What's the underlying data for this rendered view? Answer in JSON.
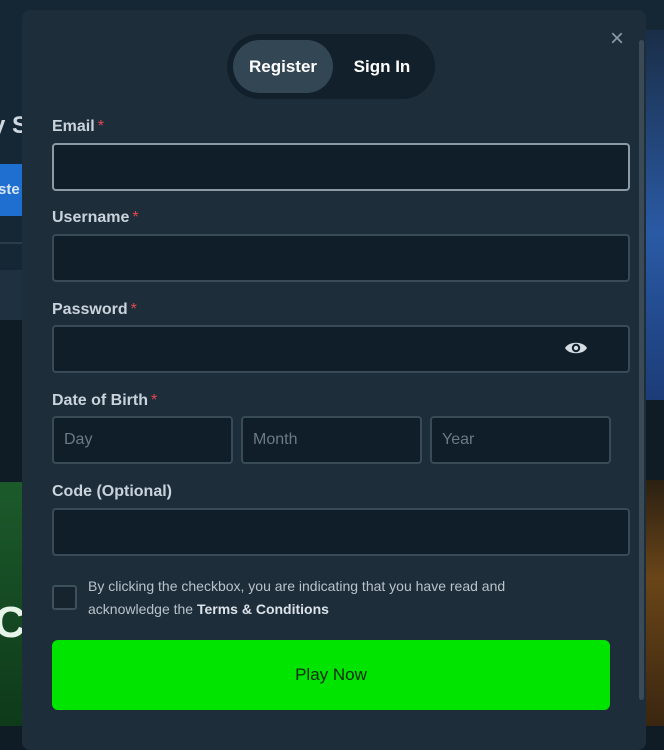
{
  "background": {
    "left_text": "y S",
    "left_button": "ste",
    "left_green_letter": "C"
  },
  "tabs": [
    {
      "label": "Register",
      "active": true
    },
    {
      "label": "Sign In",
      "active": false
    }
  ],
  "close_icon": "×",
  "form": {
    "email_label": "Email",
    "username_label": "Username",
    "password_label": "Password",
    "dob_label": "Date of Birth",
    "code_label": "Code (Optional)",
    "required_marker": "*",
    "dob": {
      "day_placeholder": "Day",
      "month_placeholder": "Month",
      "year_placeholder": "Year"
    },
    "email_value": "",
    "username_value": "",
    "password_value": "",
    "code_value": ""
  },
  "terms": {
    "text": "By clicking the checkbox, you are indicating that you have read and acknowledge the ",
    "link": "Terms & Conditions"
  },
  "submit_label": "Play Now",
  "colors": {
    "accent_green": "#00e400",
    "required_red": "#e5484d",
    "modal_bg": "#1e2d3a"
  }
}
